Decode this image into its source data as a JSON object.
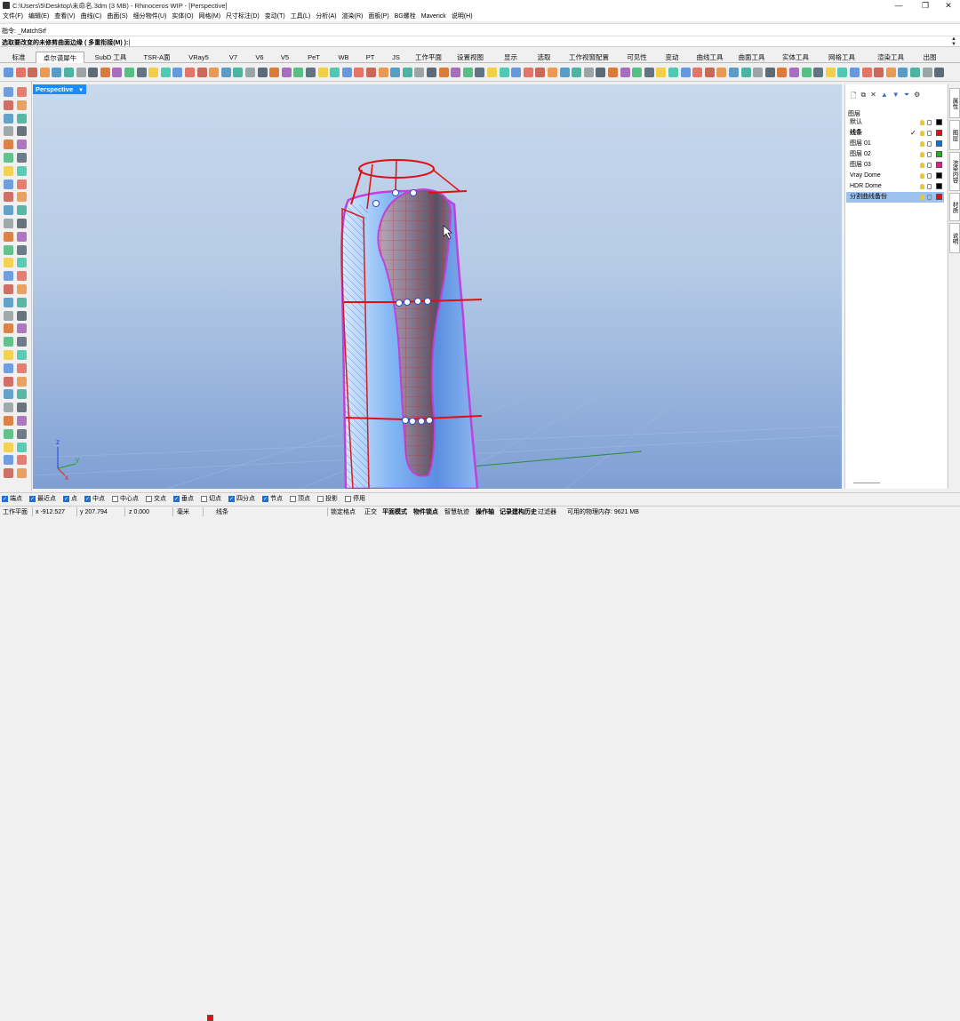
{
  "window": {
    "title": "C:\\Users\\5\\Desktop\\未命名.3dm (3 MB) - Rhinoceros WIP - [Perspective]",
    "min": "—",
    "max": "❐",
    "close": "✕"
  },
  "menu": [
    "文件(F)",
    "编辑(E)",
    "查看(V)",
    "曲线(C)",
    "曲面(S)",
    "细分物件(U)",
    "实体(O)",
    "网格(M)",
    "尺寸标注(D)",
    "变动(T)",
    "工具(L)",
    "分析(A)",
    "渲染(R)",
    "面板(P)",
    "BG螺栓",
    "Maverick",
    "说明(H)"
  ],
  "command": {
    "history": "指令: _MatchSrf",
    "prompt": "选取要改变的未修剪曲面边缘 ( 多重衔接(M) ):"
  },
  "tabs": [
    "标准",
    "卓尔谟犀牛",
    "SubD 工具",
    "TSR-A面",
    "VRay5",
    "V7",
    "V6",
    "V5",
    "PeT",
    "WB",
    "PT",
    "JS",
    "工作平面",
    "设置视图",
    "显示",
    "选取",
    "工作视窗配置",
    "可见性",
    "变动",
    "曲线工具",
    "曲面工具",
    "实体工具",
    "网格工具",
    "渲染工具",
    "出图"
  ],
  "active_tab": "卓尔谟犀牛",
  "viewport": {
    "label": "Perspective",
    "axis_x": "x",
    "axis_y": "y",
    "axis_z": "z"
  },
  "layers": {
    "header": "图层",
    "rows": [
      {
        "name": "默认",
        "color": "#000000",
        "bold": false,
        "current": false,
        "selected": false
      },
      {
        "name": "线条",
        "color": "#e01010",
        "bold": true,
        "current": true,
        "selected": false
      },
      {
        "name": "图层 01",
        "color": "#1a6fd6",
        "bold": false,
        "current": false,
        "selected": false
      },
      {
        "name": "图层 02",
        "color": "#20b020",
        "bold": false,
        "current": false,
        "selected": false
      },
      {
        "name": "图层 03",
        "color": "#e0208a",
        "bold": false,
        "current": false,
        "selected": false
      },
      {
        "name": "Vray Dome",
        "color": "#000000",
        "bold": false,
        "current": false,
        "selected": false
      },
      {
        "name": "HDR Dome",
        "color": "#000000",
        "bold": false,
        "current": false,
        "selected": false
      },
      {
        "name": "分割曲线备份",
        "color": "#e01010",
        "bold": false,
        "current": false,
        "selected": true
      }
    ],
    "current_mark": "✓"
  },
  "side_tabs": [
    "属性",
    "图层",
    "渲染内容",
    "材质",
    "说明"
  ],
  "osnap": [
    {
      "label": "端点",
      "on": true
    },
    {
      "label": "最近点",
      "on": true
    },
    {
      "label": "点",
      "on": true
    },
    {
      "label": "中点",
      "on": true
    },
    {
      "label": "中心点",
      "on": false
    },
    {
      "label": "交点",
      "on": false
    },
    {
      "label": "垂点",
      "on": true
    },
    {
      "label": "切点",
      "on": false
    },
    {
      "label": "四分点",
      "on": true
    },
    {
      "label": "节点",
      "on": true
    },
    {
      "label": "顶点",
      "on": false
    },
    {
      "label": "投影",
      "on": false
    },
    {
      "label": "停用",
      "on": false
    }
  ],
  "status": {
    "cplane": "工作平面",
    "x": "x -912.527",
    "y": "y 207.794",
    "z": "z 0.000",
    "units": "毫米",
    "layer": "线条",
    "layer_color": "#e01010",
    "toggles": [
      "锁定格点",
      "正交",
      "平面模式",
      "物件锁点",
      "智慧轨迹",
      "操作轴",
      "记录建构历史",
      "过滤器"
    ],
    "bold_toggles": [
      "平面模式",
      "物件锁点",
      "操作轴",
      "记录建构历史"
    ],
    "memory": "可用的物理内存: 9621 MB"
  }
}
